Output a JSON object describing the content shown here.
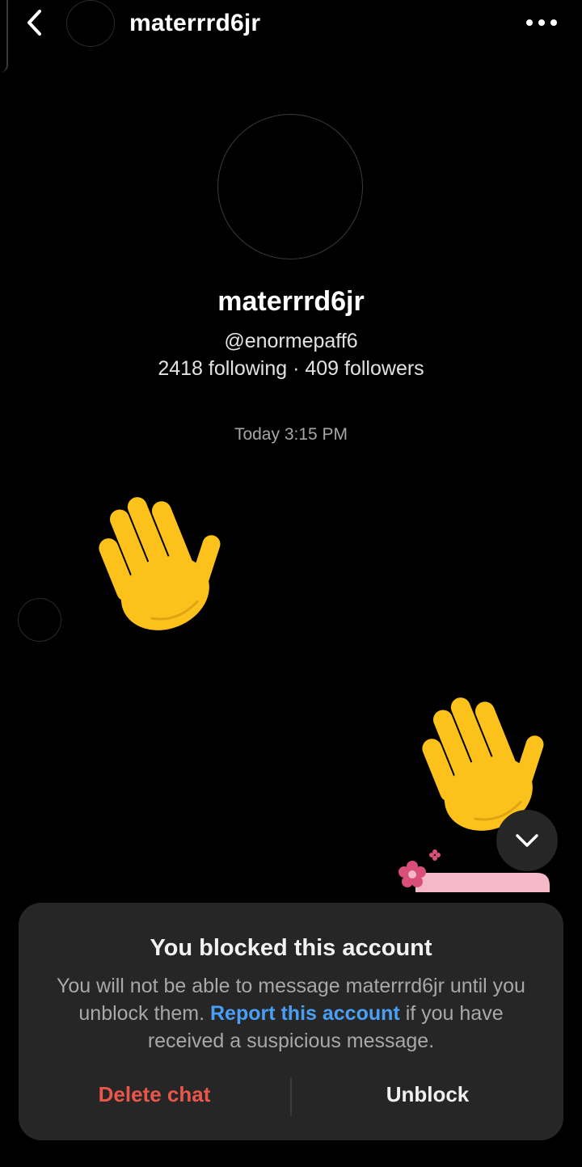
{
  "header": {
    "title": "materrrd6jr",
    "back_icon": "chevron-left-icon",
    "more_icon": "more-horizontal-icon"
  },
  "profile": {
    "name": "materrrd6jr",
    "handle": "@enormepaff6",
    "stats": "2418 following · 409 followers"
  },
  "conversation": {
    "timestamp": "Today 3:15 PM",
    "messages": [
      {
        "from": "them",
        "content": "waving-hand-emoji"
      },
      {
        "from": "me",
        "content": "waving-hand-emoji"
      }
    ],
    "sticker": "flower-sticker"
  },
  "blocked_panel": {
    "title": "You blocked this account",
    "desc_before": "You will not be able to message materrrd6jr until you unblock them.",
    "report_link": "Report this account",
    "desc_after": "if you have received a suspicious message.",
    "delete_label": "Delete chat",
    "unblock_label": "Unblock"
  },
  "colors": {
    "background": "#000000",
    "panel": "#262626",
    "link": "#4a9ff5",
    "danger": "#e8574a",
    "emoji": "#fcc21b"
  }
}
